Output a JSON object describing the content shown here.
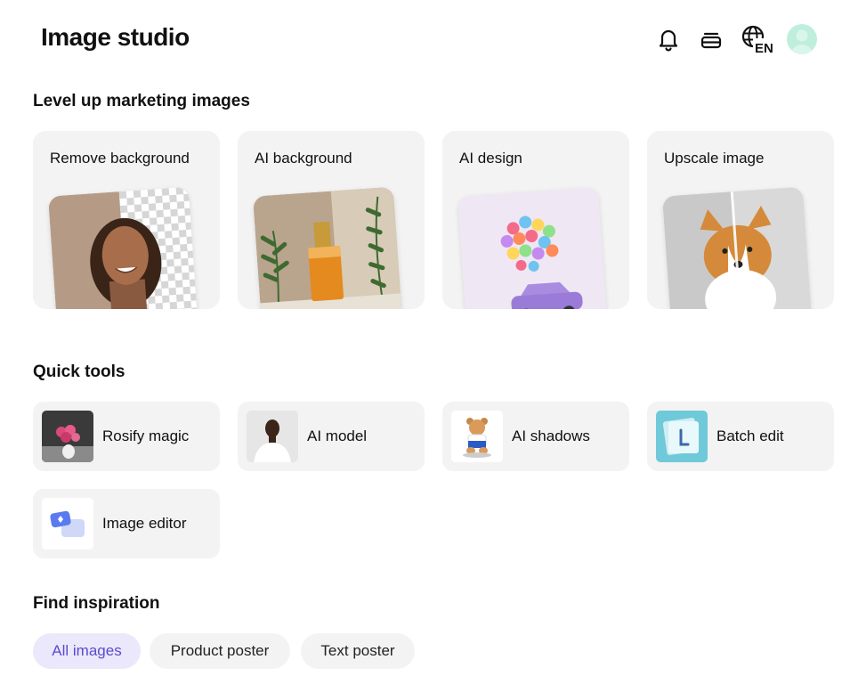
{
  "header": {
    "title": "Image studio",
    "language_badge": "EN",
    "icons": [
      "bell-icon",
      "layers-icon",
      "globe-icon",
      "avatar"
    ]
  },
  "marketing": {
    "heading": "Level up marketing images",
    "cards": [
      {
        "label": "Remove background"
      },
      {
        "label": "AI background"
      },
      {
        "label": "AI design"
      },
      {
        "label": "Upscale image"
      }
    ]
  },
  "quick_tools": {
    "heading": "Quick tools",
    "items": [
      {
        "label": "Rosify magic"
      },
      {
        "label": "AI model"
      },
      {
        "label": "AI shadows"
      },
      {
        "label": "Batch edit"
      },
      {
        "label": "Image editor"
      }
    ]
  },
  "inspiration": {
    "heading": "Find inspiration",
    "chips": [
      {
        "label": "All images",
        "active": true
      },
      {
        "label": "Product poster",
        "active": false
      },
      {
        "label": "Text poster",
        "active": false
      }
    ]
  },
  "colors": {
    "card_bg": "#f3f3f3",
    "active_chip_bg": "#ebe8fb",
    "active_chip_text": "#5a4bcf",
    "avatar_bg": "#bfeedd"
  }
}
